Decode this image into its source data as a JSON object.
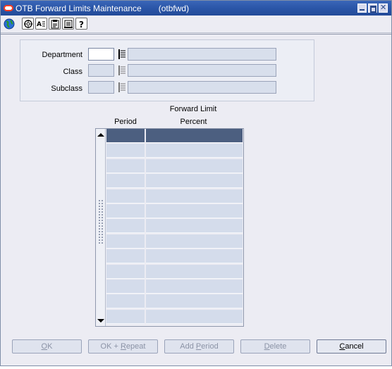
{
  "window": {
    "title": "OTB Forward Limits Maintenance",
    "form_code": "(otbfwd)"
  },
  "toolbar": {
    "items": [
      "globe-icon",
      "wheel-icon",
      "text-find-icon",
      "clipboard-icon",
      "notes-icon",
      "help-icon"
    ]
  },
  "fields": {
    "department": {
      "label": "Department",
      "code": "",
      "description": ""
    },
    "class": {
      "label": "Class",
      "code": "",
      "description": ""
    },
    "subclass": {
      "label": "Subclass",
      "code": "",
      "description": ""
    }
  },
  "grid": {
    "group_header": "Forward Limit",
    "columns": [
      "Period",
      "Percent"
    ],
    "rows": [
      {
        "period": "",
        "percent": ""
      },
      {
        "period": "",
        "percent": ""
      },
      {
        "period": "",
        "percent": ""
      },
      {
        "period": "",
        "percent": ""
      },
      {
        "period": "",
        "percent": ""
      },
      {
        "period": "",
        "percent": ""
      },
      {
        "period": "",
        "percent": ""
      },
      {
        "period": "",
        "percent": ""
      },
      {
        "period": "",
        "percent": ""
      },
      {
        "period": "",
        "percent": ""
      },
      {
        "period": "",
        "percent": ""
      },
      {
        "period": "",
        "percent": ""
      },
      {
        "period": "",
        "percent": ""
      }
    ]
  },
  "buttons": {
    "ok": {
      "prefix": "",
      "mnemonic": "O",
      "rest": "K"
    },
    "ok_repeat": {
      "prefix": "OK + ",
      "mnemonic": "R",
      "rest": "epeat"
    },
    "add_period": {
      "prefix": "Add ",
      "mnemonic": "P",
      "rest": "eriod"
    },
    "delete": {
      "prefix": "",
      "mnemonic": "D",
      "rest": "elete"
    },
    "cancel": {
      "prefix": "",
      "mnemonic": "C",
      "rest": "ancel"
    }
  },
  "colors": {
    "title_bar": "#2b56a8",
    "selected_row": "#4c5f80",
    "field_disabled": "#d8dfec",
    "grid_cell": "#d4dceb"
  }
}
